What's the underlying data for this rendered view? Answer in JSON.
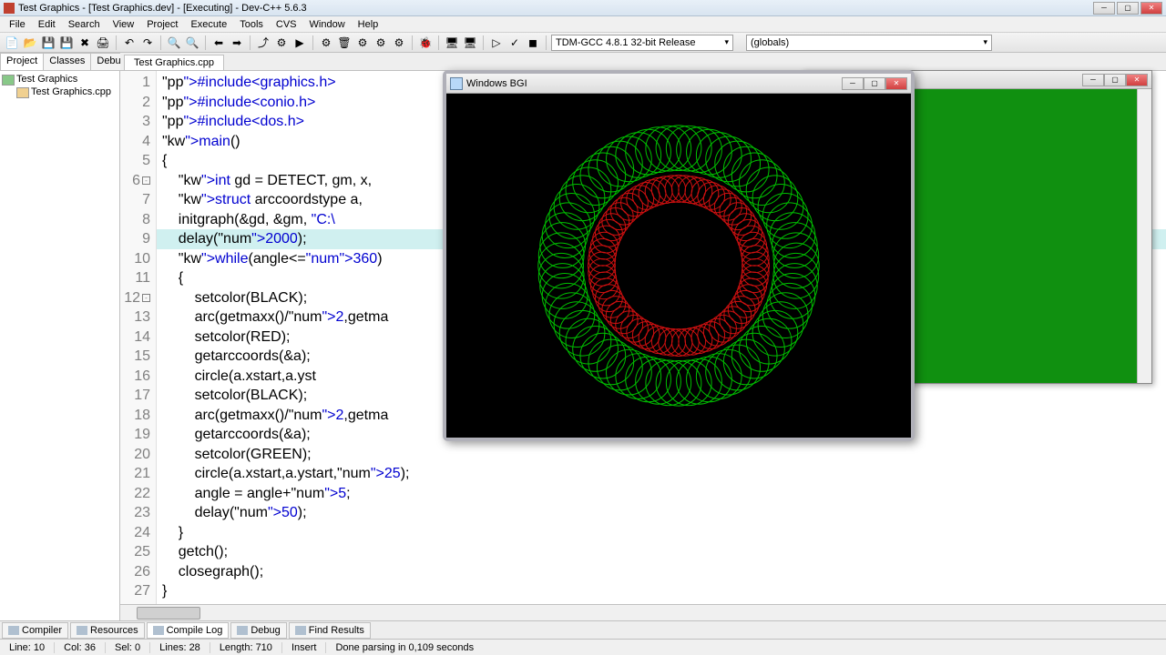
{
  "window": {
    "title": "Test Graphics - [Test Graphics.dev] - [Executing] - Dev-C++ 5.6.3"
  },
  "menu": [
    "File",
    "Edit",
    "Search",
    "View",
    "Project",
    "Execute",
    "Tools",
    "CVS",
    "Window",
    "Help"
  ],
  "combo_compiler": "TDM-GCC 4.8.1 32-bit Release",
  "combo_scope": "(globals)",
  "left_tabs": [
    "Project",
    "Classes",
    "Debug"
  ],
  "tree": {
    "root": "Test Graphics",
    "child": "Test Graphics.cpp"
  },
  "editor_tab": "Test Graphics.cpp",
  "code_lines": [
    "#include<graphics.h>",
    "#include<conio.h>",
    "#include<dos.h>",
    "",
    "main()",
    "{",
    "    int gd = DETECT, gm, x,",
    "    struct arccoordstype a,",
    "    initgraph(&gd, &gm, \"C:\\",
    "    delay(2000);",
    "    while(angle<=360)",
    "    {",
    "        setcolor(BLACK);",
    "        arc(getmaxx()/2,getma",
    "        setcolor(RED);",
    "        getarccoords(&a);",
    "        circle(a.xstart,a.yst",
    "        setcolor(BLACK);",
    "        arc(getmaxx()/2,getma",
    "        getarccoords(&a);",
    "        setcolor(GREEN);",
    "        circle(a.xstart,a.ystart,25);",
    "        angle = angle+5;",
    "        delay(50);",
    "    }",
    "    getch();",
    "    closegraph();",
    "}"
  ],
  "highlight_line": 10,
  "bgi": {
    "title": "Windows BGI"
  },
  "bottom_tabs": [
    "Compiler",
    "Resources",
    "Compile Log",
    "Debug",
    "Find Results"
  ],
  "bottom_active": 2,
  "status": {
    "line": "Line:   10",
    "col": "Col:   36",
    "sel": "Sel:   0",
    "lines": "Lines:   28",
    "length": "Length:   710",
    "mode": "Insert",
    "msg": "Done parsing in 0,109 seconds"
  },
  "chart_data": {
    "type": "spirograph",
    "description": "Two concentric rings of overlapping arc-generated circles on black background",
    "background": "#000000",
    "rings": [
      {
        "color": "GREEN",
        "hex": "#00c000",
        "big_radius": 130,
        "small_radius": 25,
        "angle_step": 5,
        "count": 72
      },
      {
        "color": "RED",
        "hex": "#d01010",
        "big_radius": 85,
        "small_radius": 15,
        "angle_step": 5,
        "count": 72
      }
    ],
    "center": [
      255,
      190
    ]
  }
}
